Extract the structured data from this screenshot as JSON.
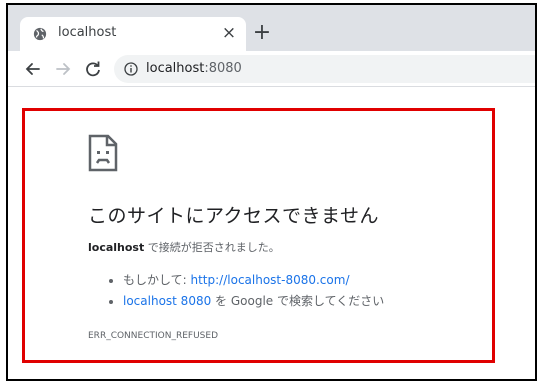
{
  "tab": {
    "title": "localhost",
    "close_glyph": "×",
    "favicon": "globe-icon"
  },
  "newtab": {
    "glyph": "+"
  },
  "toolbar": {
    "url_host": "localhost",
    "url_port": ":8080"
  },
  "error": {
    "title": "このサイトにアクセスできません",
    "host": "localhost",
    "message": " で接続が拒否されました。",
    "suggestion_1_prefix": "もしかして: ",
    "suggestion_1_link": "http://localhost-8080.com/",
    "suggestion_2_link": "localhost 8080",
    "suggestion_2_text": " を Google で検索してください",
    "code": "ERR_CONNECTION_REFUSED"
  },
  "colors": {
    "highlight_border": "#e00000",
    "link": "#1a73e8",
    "tabstrip": "#dee1e6"
  }
}
